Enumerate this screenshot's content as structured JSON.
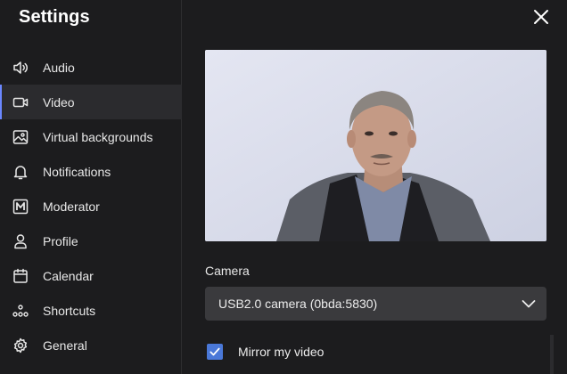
{
  "header": {
    "title": "Settings"
  },
  "sidebar": {
    "items": [
      {
        "label": "Audio",
        "icon": "speaker-icon",
        "active": false
      },
      {
        "label": "Video",
        "icon": "video-camera-icon",
        "active": true
      },
      {
        "label": "Virtual backgrounds",
        "icon": "image-icon",
        "active": false
      },
      {
        "label": "Notifications",
        "icon": "bell-icon",
        "active": false
      },
      {
        "label": "Moderator",
        "icon": "moderator-m-icon",
        "active": false
      },
      {
        "label": "Profile",
        "icon": "person-icon",
        "active": false
      },
      {
        "label": "Calendar",
        "icon": "calendar-icon",
        "active": false
      },
      {
        "label": "Shortcuts",
        "icon": "shortcuts-icon",
        "active": false
      },
      {
        "label": "General",
        "icon": "gear-icon",
        "active": false
      }
    ]
  },
  "video": {
    "camera_label": "Camera",
    "camera_selected": "USB2.0 camera (0bda:5830)",
    "mirror_label": "Mirror my video",
    "mirror_checked": true
  },
  "colors": {
    "background": "#1c1c1e",
    "active_item": "#2b2b2e",
    "accent": "#6b87ff",
    "select_bg": "#3a3a3d",
    "checkbox": "#4a78d8"
  }
}
